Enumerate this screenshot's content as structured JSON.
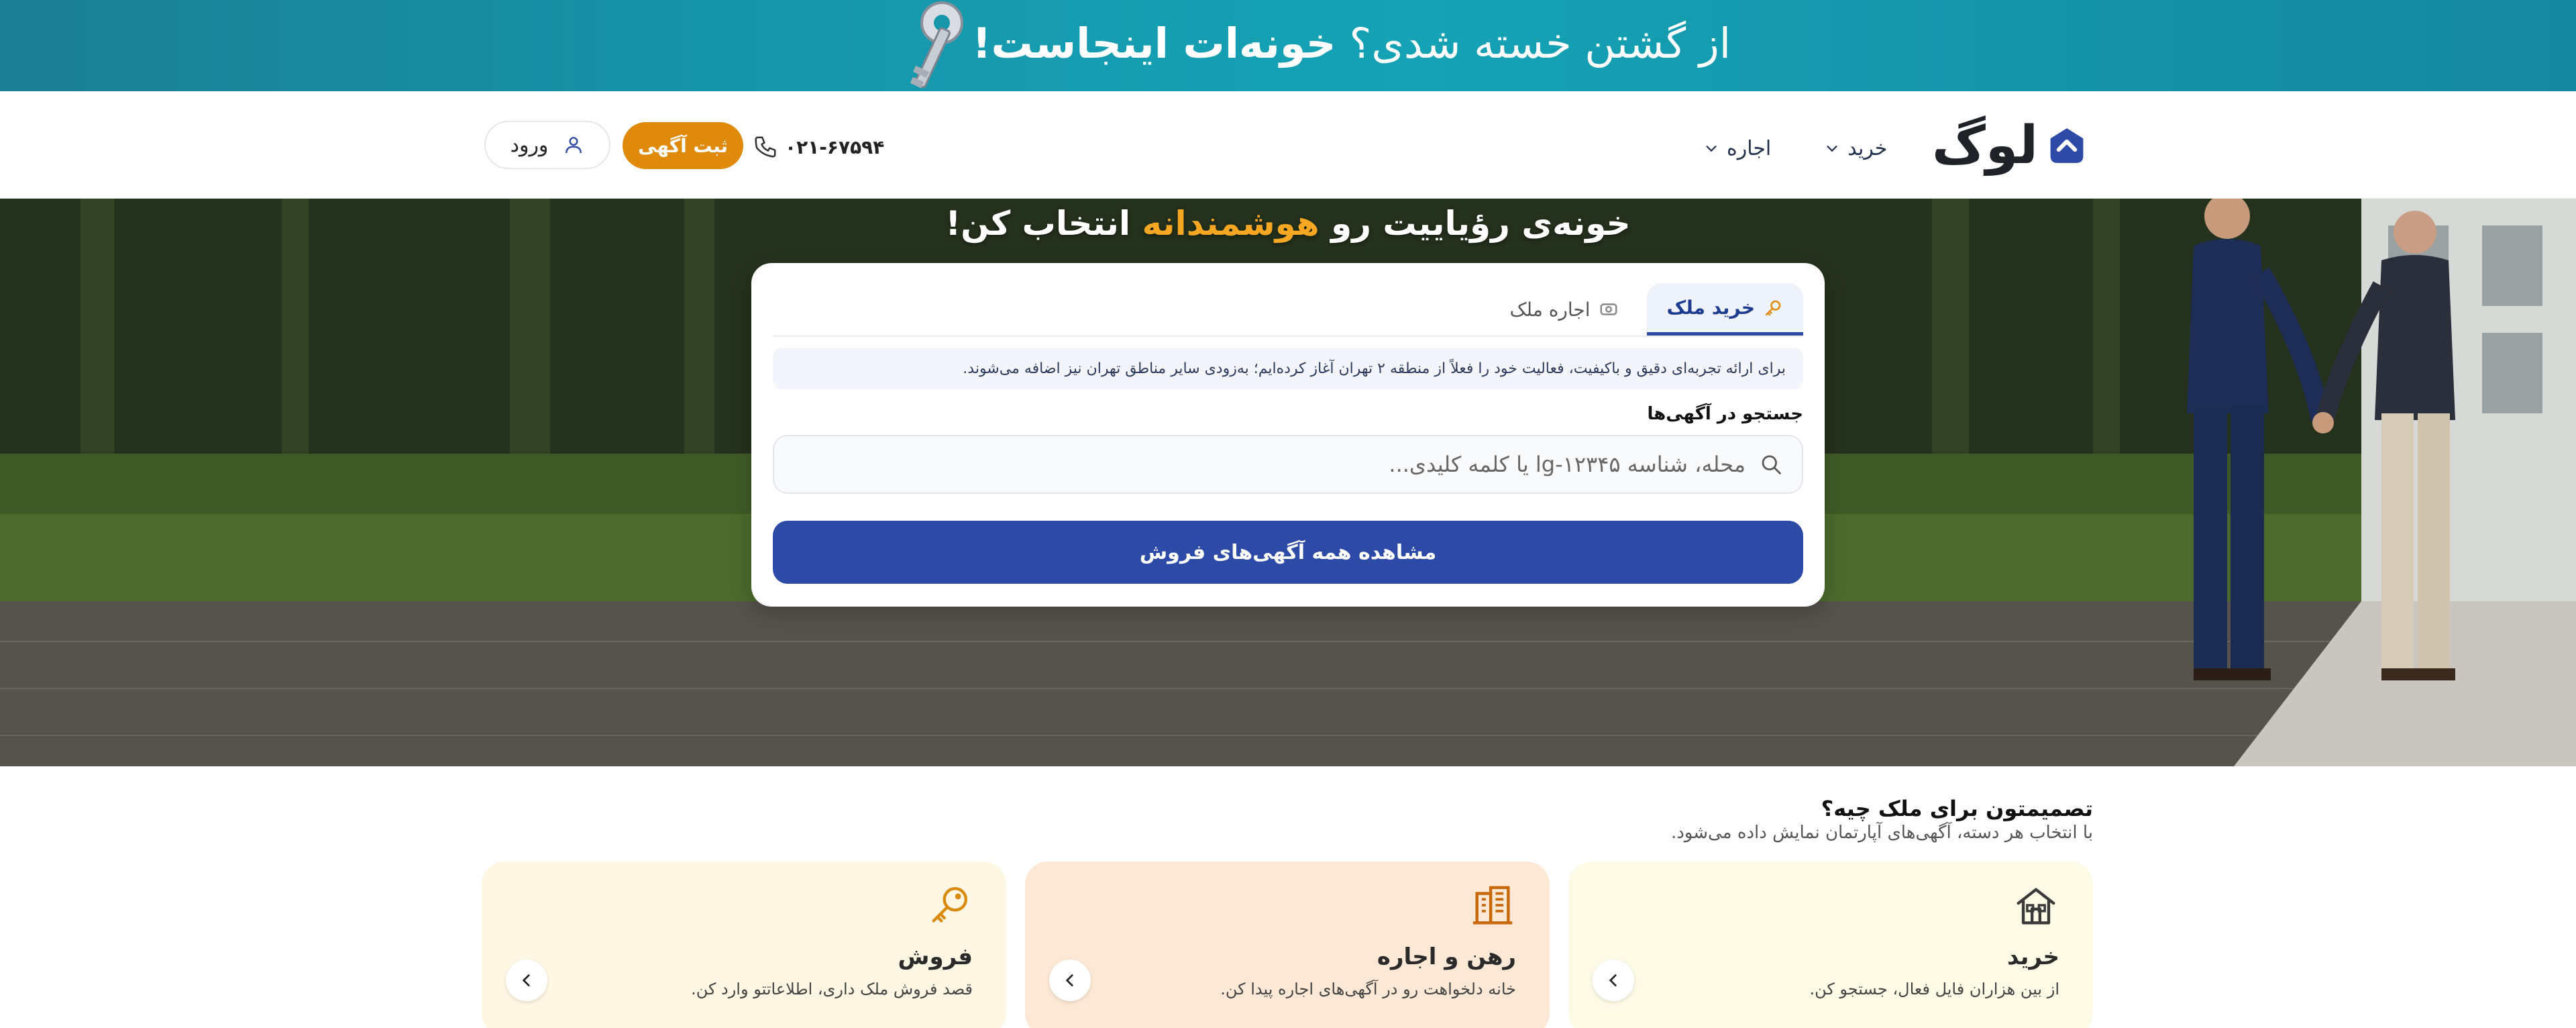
{
  "promo": {
    "text_light": "از گشتن خسته شدی؟",
    "text_bold": "خونه‌ات اینجاست!"
  },
  "header": {
    "logo_text": "لوگ",
    "nav": [
      {
        "label": "خرید"
      },
      {
        "label": "اجاره"
      }
    ],
    "phone": "۰۲۱-۶۷۵۹۴",
    "post_button": "ثبت آگهی",
    "login_button": "ورود"
  },
  "hero": {
    "title_before": "خونه‌ی رؤیاییت رو",
    "title_accent": "هوشمندانه",
    "title_after": "انتخاب کن!",
    "accent_color": "#f5a623"
  },
  "search": {
    "tabs": [
      {
        "label": "خرید ملک",
        "active": true
      },
      {
        "label": "اجاره ملک",
        "active": false
      }
    ],
    "notice": "برای ارائه تجربه‌ای دقیق و باکیفیت، فعالیت خود را فعلاً از منطقه ۲ تهران آغاز کرده‌ایم؛ به‌زودی سایر مناطق تهران نیز اضافه می‌شوند.",
    "label": "جستجو در آگهی‌ها",
    "placeholder": "محله، شناسه lg-۱۲۳۴۵ یا کلمه کلیدی...",
    "all_button": "مشاهده همه آگهی‌های فروش",
    "primary_color": "#2c4aa6"
  },
  "decision": {
    "title": "تصمیمتون برای ملک چیه؟",
    "subtitle": "با انتخاب هر دسته، آگهی‌های آپارتمان نمایش داده می‌شود.",
    "cards": [
      {
        "title": "خرید",
        "desc": "از بین هزاران فایل فعال، جستجو کن.",
        "icon": "house-icon"
      },
      {
        "title": "رهن و اجاره",
        "desc": "خانه دلخواهت رو در آگهی‌های اجاره پیدا کن.",
        "icon": "building-icon"
      },
      {
        "title": "فروش",
        "desc": "قصد فروش ملک داری، اطلاعاتتو وارد کن.",
        "icon": "key-icon"
      }
    ]
  }
}
